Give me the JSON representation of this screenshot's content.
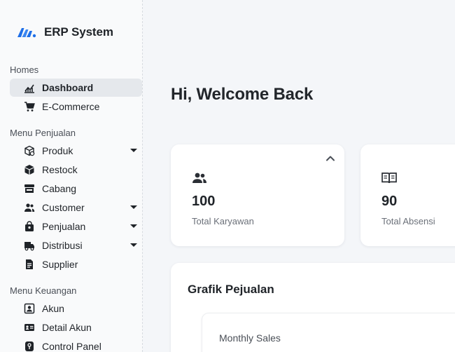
{
  "brand": {
    "name": "ERP System",
    "logo": "m-logo-icon",
    "color": "#1e6fe8"
  },
  "sidebar": {
    "sections": [
      {
        "title": "Homes",
        "items": [
          {
            "label": "Dashboard",
            "icon": "chart-line-icon",
            "active": true
          },
          {
            "label": "E-Commerce",
            "icon": "cart-icon"
          }
        ]
      },
      {
        "title": "Menu Penjualan",
        "items": [
          {
            "label": "Produk",
            "icon": "package-icon",
            "caret": true
          },
          {
            "label": "Restock",
            "icon": "cube-icon"
          },
          {
            "label": "Cabang",
            "icon": "store-icon"
          },
          {
            "label": "Customer",
            "icon": "users-icon",
            "caret": true
          },
          {
            "label": "Penjualan",
            "icon": "shopping-bag-icon",
            "caret": true
          },
          {
            "label": "Distribusi",
            "icon": "truck-icon",
            "caret": true
          },
          {
            "label": "Supplier",
            "icon": "document-icon"
          }
        ]
      },
      {
        "title": "Menu Keuangan",
        "items": [
          {
            "label": "Akun",
            "icon": "account-box-icon"
          },
          {
            "label": "Detail Akun",
            "icon": "id-card-icon"
          },
          {
            "label": "Control Panel",
            "icon": "control-panel-icon"
          }
        ]
      }
    ]
  },
  "main": {
    "welcome": "Hi, Welcome Back",
    "stats": [
      {
        "value": "100",
        "label": "Total Karyawan",
        "icon": "users-icon"
      },
      {
        "value": "90",
        "label": "Total Absensi",
        "icon": "book-icon"
      }
    ],
    "chart": {
      "title": "Grafik Pejualan",
      "inner_title": "Monthly Sales"
    }
  }
}
